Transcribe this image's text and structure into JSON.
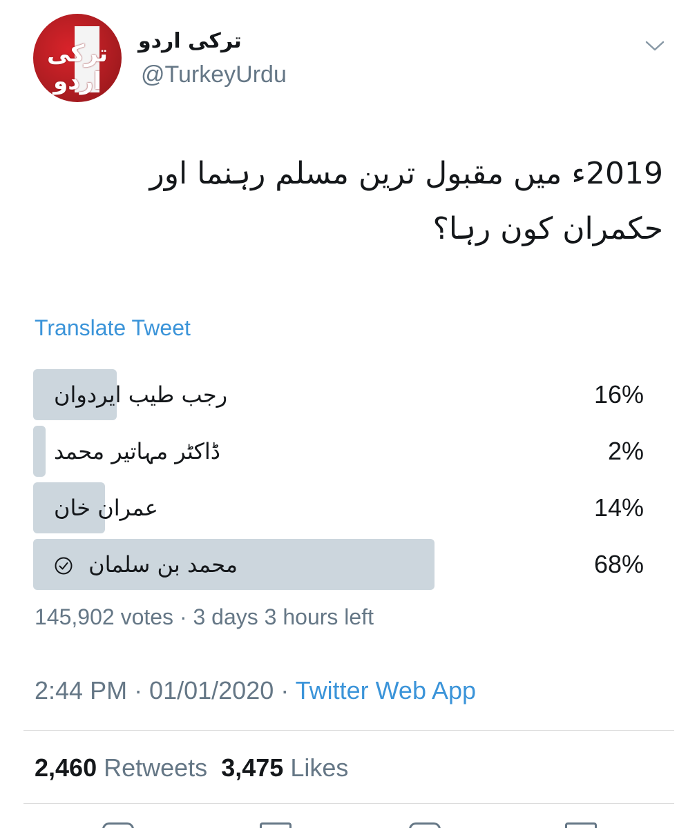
{
  "account": {
    "display_name": "ترکی اردو",
    "handle": "@TurkeyUrdu",
    "avatar_text": "ترکی اردو",
    "avatar_color": "#c41e24"
  },
  "tweet": {
    "text_line1": "2019ء میں مقبول ترین مسلم رہنما اور",
    "text_line2": "حکمران کون رہا؟",
    "translate_label": "Translate Tweet"
  },
  "poll": {
    "options": [
      {
        "label": "رجب طیب ایردوان",
        "percent_text": "16%",
        "percent": 16,
        "winner": false
      },
      {
        "label": "ڈاکٹر مہاتیر محمد",
        "percent_text": "2%",
        "percent": 2,
        "winner": false
      },
      {
        "label": "عمران خان",
        "percent_text": "14%",
        "percent": 14,
        "winner": false
      },
      {
        "label": "محمد بن سلمان",
        "percent_text": "68%",
        "percent": 68,
        "winner": true
      }
    ],
    "meta": "145,902 votes · 3 days 3 hours left",
    "bar_color": "#ccd6dd"
  },
  "timestamp": {
    "time_date": "2:44 PM · 01/01/2020 · ",
    "source": "Twitter Web App"
  },
  "stats": {
    "retweets_count": "2,460",
    "retweets_label": "Retweets",
    "likes_count": "3,475",
    "likes_label": "Likes"
  },
  "colors": {
    "link": "#3b94d9",
    "secondary_text": "#657786"
  }
}
